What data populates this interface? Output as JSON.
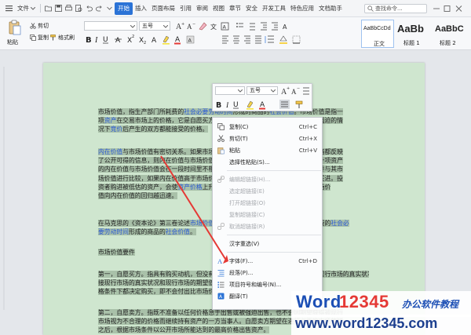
{
  "menubar": {
    "file_label": "文件",
    "tabs": [
      "开始",
      "插入",
      "页面布局",
      "引用",
      "审阅",
      "视图",
      "章节",
      "安全",
      "开发工具",
      "特色应用",
      "文档助手"
    ],
    "active_tab": "开始",
    "search_label": "查找命令..."
  },
  "ribbon": {
    "paste_label": "粘贴",
    "cut_label": "剪切",
    "copy_label": "复制",
    "format_painter_label": "格式刷",
    "font_size_value": "五号",
    "styles": [
      {
        "preview": "AaBbCcDd",
        "name": "正文"
      },
      {
        "preview": "AaBb",
        "name": "标题 1"
      },
      {
        "preview": "AaBbC",
        "name": "标题 2"
      }
    ]
  },
  "mini_toolbar": {
    "font_size_value": "五号"
  },
  "document": {
    "paragraphs": [
      {
        "lines": [
          [
            {
              "t": "市场价值，指生产部门所耗费的"
            },
            {
              "t": "社会必要劳动时间",
              "c": "link"
            },
            {
              "t": "形成的商品的"
            },
            {
              "t": "社会价值",
              "c": "link"
            },
            {
              "t": "。市场价值是指一"
            }
          ],
          [
            {
              "t": "项"
            },
            {
              "t": "资产",
              "c": "link"
            },
            {
              "t": "在交易市场上的价格，它是自愿买方和自愿卖方在各自理性行事且未受任何强迫的情"
            }
          ],
          [
            {
              "t": "况下"
            },
            {
              "t": "竞价",
              "c": "link"
            },
            {
              "t": "后产生的双方都能接受的价格。"
            }
          ]
        ]
      },
      {
        "lines": [
          [
            {
              "t": "内在价值",
              "c": "link"
            },
            {
              "t": "与市场价值有密切关系。如果市场是有效的，即所有资产在任何时候的价格都反映"
            }
          ],
          [
            {
              "t": "了公开可得的信息，则内在价值与市场价值应当相等。如果市场不是完全有效的，一项资产"
            }
          ],
          [
            {
              "t": "的内在价值与市场价值会在一段时间里不相等。投资者估计了一种资产的内在价值并与其市"
            }
          ],
          [
            {
              "t": "场价值进行比较，如果内在价值高于市场价值则认为资产被市场低估了，他会决定买进。投"
            }
          ],
          [
            {
              "t": "资者购进被低估的资产，会使"
            },
            {
              "t": "资产价格",
              "c": "link"
            },
            {
              "t": "上升，趋向于内在价值。市场越有效率，市场价"
            }
          ],
          [
            {
              "t": "值向内在价值的回归越迅速。"
            }
          ]
        ]
      },
      {
        "lines": [
          [
            {
              "t": "在马克思的《资本论》第三卷论述"
            },
            {
              "t": "市场价值",
              "c": "link"
            },
            {
              "t": "时曾指出，市场价值是指生产部门所耗费的"
            },
            {
              "t": "社会必",
              "c": "link"
            }
          ],
          [
            {
              "t": "要劳动时间",
              "c": "link"
            },
            {
              "t": "形成的商品的"
            },
            {
              "t": "社会价值",
              "c": "link"
            },
            {
              "t": "。"
            }
          ]
        ]
      },
      {
        "lines": [
          [
            {
              "t": "市场价值要件"
            }
          ]
        ]
      },
      {
        "lines": [
          [
            {
              "t": "第一，自愿买方。指具有购买动机，但没有被迫进行购买的一方。该购买者会根据现行市场的真实状况和现行市场的期望值进行购买，不会在任何价"
            }
          ],
          [
            {
              "t": "接现行市场的真实状况和现行市场的期望值进行购买，不会在任何价"
            }
          ],
          [
            {
              "t": "格条件下都决定购买，即不会付出比市场价格更高的价格。"
            }
          ]
        ]
      },
      {
        "lines": [
          [
            {
              "t": "第二，自愿卖方。指既不准备以任何价格急于出售或被强迫出售，也不会因期望获得被现行"
            }
          ],
          [
            {
              "t": "市场视为不合理的价格而继续持有资产的一方当事人。自愿卖方期望在进行必要的市场营销"
            }
          ],
          [
            {
              "t": "之后，根据市场条件以公开市场所能达到的最高价格出售资产。"
            }
          ]
        ]
      }
    ]
  },
  "context_menu": {
    "items": [
      {
        "label": "复制(C)",
        "shortcut": "Ctrl+C",
        "icon": "copy-icon",
        "enabled": true
      },
      {
        "label": "剪切(T)",
        "shortcut": "Ctrl+X",
        "icon": "scissors-icon",
        "enabled": true
      },
      {
        "label": "粘贴",
        "shortcut": "Ctrl+V",
        "icon": "paste-icon",
        "enabled": true
      },
      {
        "label": "选择性粘贴(S)...",
        "shortcut": "",
        "icon": "",
        "enabled": true
      },
      {
        "label": "编辑超链接(H)...",
        "shortcut": "",
        "icon": "link-icon",
        "enabled": false
      },
      {
        "label": "选定超链接(E)",
        "shortcut": "",
        "icon": "",
        "enabled": false
      },
      {
        "label": "打开超链接(O)",
        "shortcut": "",
        "icon": "",
        "enabled": false
      },
      {
        "label": "复制超链接(C)",
        "shortcut": "",
        "icon": "",
        "enabled": false
      },
      {
        "label": "取消超链接(R)",
        "shortcut": "",
        "icon": "unlink-icon",
        "enabled": false
      },
      {
        "label": "汉字重选(V)",
        "shortcut": "",
        "icon": "",
        "enabled": true
      },
      {
        "label": "字体(F)...",
        "shortcut": "Ctrl+D",
        "icon": "font-icon",
        "enabled": true
      },
      {
        "label": "段落(P)...",
        "shortcut": "",
        "icon": "paragraph-icon",
        "enabled": true
      },
      {
        "label": "项目符号和编号(N)...",
        "shortcut": "",
        "icon": "bullets-icon",
        "enabled": true
      },
      {
        "label": "翻译(T)",
        "shortcut": "",
        "icon": "translate-icon",
        "enabled": true
      }
    ]
  },
  "watermark": {
    "brand_prefix": "Word",
    "brand_number": "12345",
    "tagline": "办公软件教程",
    "url": "www.word12345.com"
  },
  "colors": {
    "accent": "#2b73d6",
    "page_bg": "#cfe6cf",
    "selection": "#a9c1a9",
    "link": "#2a5ad6",
    "arrow": "#e53935"
  }
}
